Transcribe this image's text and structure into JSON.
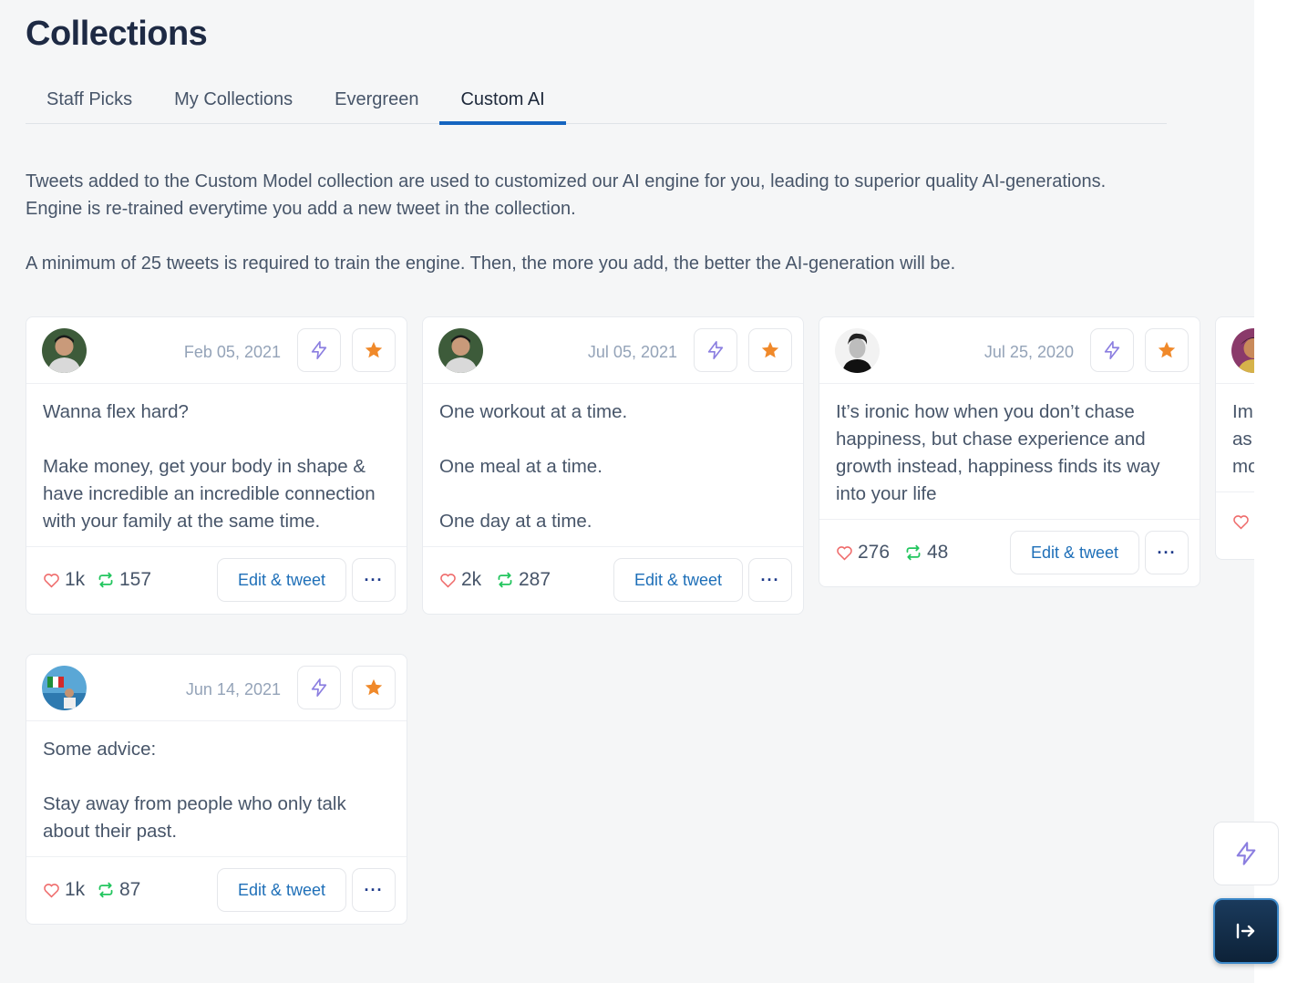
{
  "page": {
    "title": "Collections"
  },
  "tabs": [
    {
      "label": "Staff Picks",
      "active": false
    },
    {
      "label": "My Collections",
      "active": false
    },
    {
      "label": "Evergreen",
      "active": false
    },
    {
      "label": "Custom AI",
      "active": true
    }
  ],
  "description": {
    "p1": "Tweets added to the Custom Model collection are used to customized our AI engine for you, leading to superior quality AI-generations. Engine is re-trained everytime you add a new tweet in the collection.",
    "p2": "A minimum of 25 tweets is required to train the engine. Then, the more you add, the better the AI-generation will be."
  },
  "cards": [
    {
      "date": "Feb 05, 2021",
      "text": "Wanna flex hard?\n\nMake money, get your body in shape & have incredible an incredible connection with your family at the same time.",
      "likes": "1k",
      "retweets": "157",
      "edit_label": "Edit & tweet",
      "more_label": "···",
      "avatar": "avatar-man-dark-hair"
    },
    {
      "date": "Jul 05, 2021",
      "text": "One workout at a time.\n\nOne meal at a time.\n\nOne day at a time.",
      "likes": "2k",
      "retweets": "287",
      "edit_label": "Edit & tweet",
      "more_label": "···",
      "avatar": "avatar-man-dark-hair"
    },
    {
      "date": "Jul 25, 2020",
      "text": "It’s ironic how when you don’t chase happiness, but chase experience and growth instead, happiness finds its way into your life",
      "likes": "276",
      "retweets": "48",
      "edit_label": "Edit & tweet",
      "more_label": "···",
      "avatar": "avatar-man-bw"
    },
    {
      "date": "Jun 14, 2021",
      "text": "Some advice:\n\nStay away from people who only talk about their past.",
      "likes": "1k",
      "retweets": "87",
      "edit_label": "Edit & tweet",
      "more_label": "···",
      "avatar": "avatar-flag"
    },
    {
      "date": "",
      "text": "Im\nas\nmo",
      "likes": "",
      "retweets": "",
      "avatar": "avatar-colorful"
    }
  ],
  "colors": {
    "accent": "#1565c0",
    "star": "#f0892a",
    "bolt": "#8b7ee0",
    "heart": "#ef6b6b",
    "retweet": "#22c55e",
    "link": "#1e6fb8"
  },
  "fab": {
    "bolt_icon": "bolt-icon",
    "exit_icon": "exit-arrow-icon"
  }
}
